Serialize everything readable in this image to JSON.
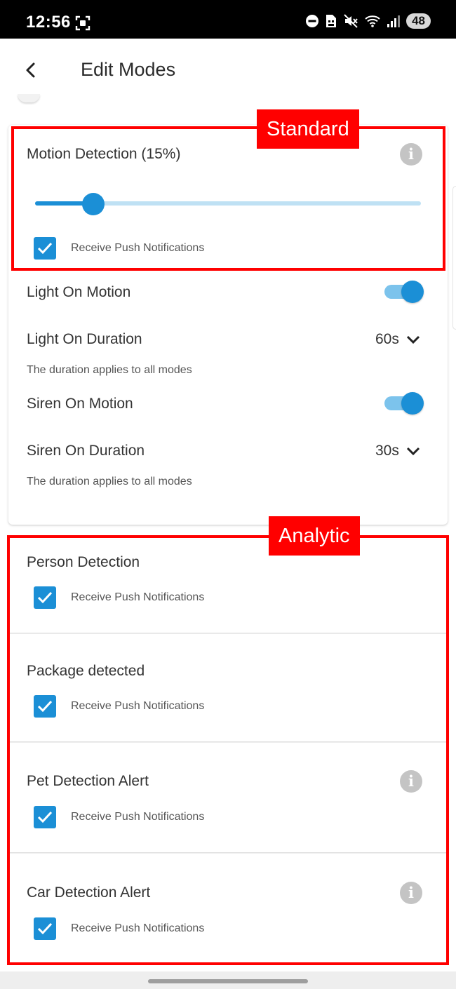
{
  "status_bar": {
    "time": "12:56",
    "battery": "48"
  },
  "app_bar": {
    "title": "Edit Modes"
  },
  "annotations": {
    "standard_tag": "Standard",
    "analytic_tag": "Analytic",
    "color": "#ff0000"
  },
  "standard": {
    "motion_detection_label": "Motion Detection (15%)",
    "sensitivity_fraction": 0.15,
    "motion_push_label": "Receive Push Notifications",
    "light_on_motion_label": "Light On Motion",
    "light_on_motion_enabled": true,
    "light_on_duration_label": "Light On Duration",
    "light_on_duration_value": "60s",
    "light_on_duration_hint": "The duration applies to all modes",
    "siren_on_motion_label": "Siren On Motion",
    "siren_on_motion_enabled": true,
    "siren_on_duration_label": "Siren On Duration",
    "siren_on_duration_value": "30s",
    "siren_on_duration_hint": "The duration applies to all modes"
  },
  "analytic": [
    {
      "label": "Person Detection",
      "push_label": "Receive Push Notifications",
      "checked": true,
      "info": false
    },
    {
      "label": "Package detected",
      "push_label": "Receive Push Notifications",
      "checked": true,
      "info": false
    },
    {
      "label": "Pet Detection Alert",
      "push_label": "Receive Push Notifications",
      "checked": true,
      "info": true
    },
    {
      "label": "Car Detection Alert",
      "push_label": "Receive Push Notifications",
      "checked": true,
      "info": true
    }
  ],
  "colors": {
    "accent": "#1b8fd6",
    "accent_light": "#bfe1f4",
    "annotation": "#ff0000"
  }
}
